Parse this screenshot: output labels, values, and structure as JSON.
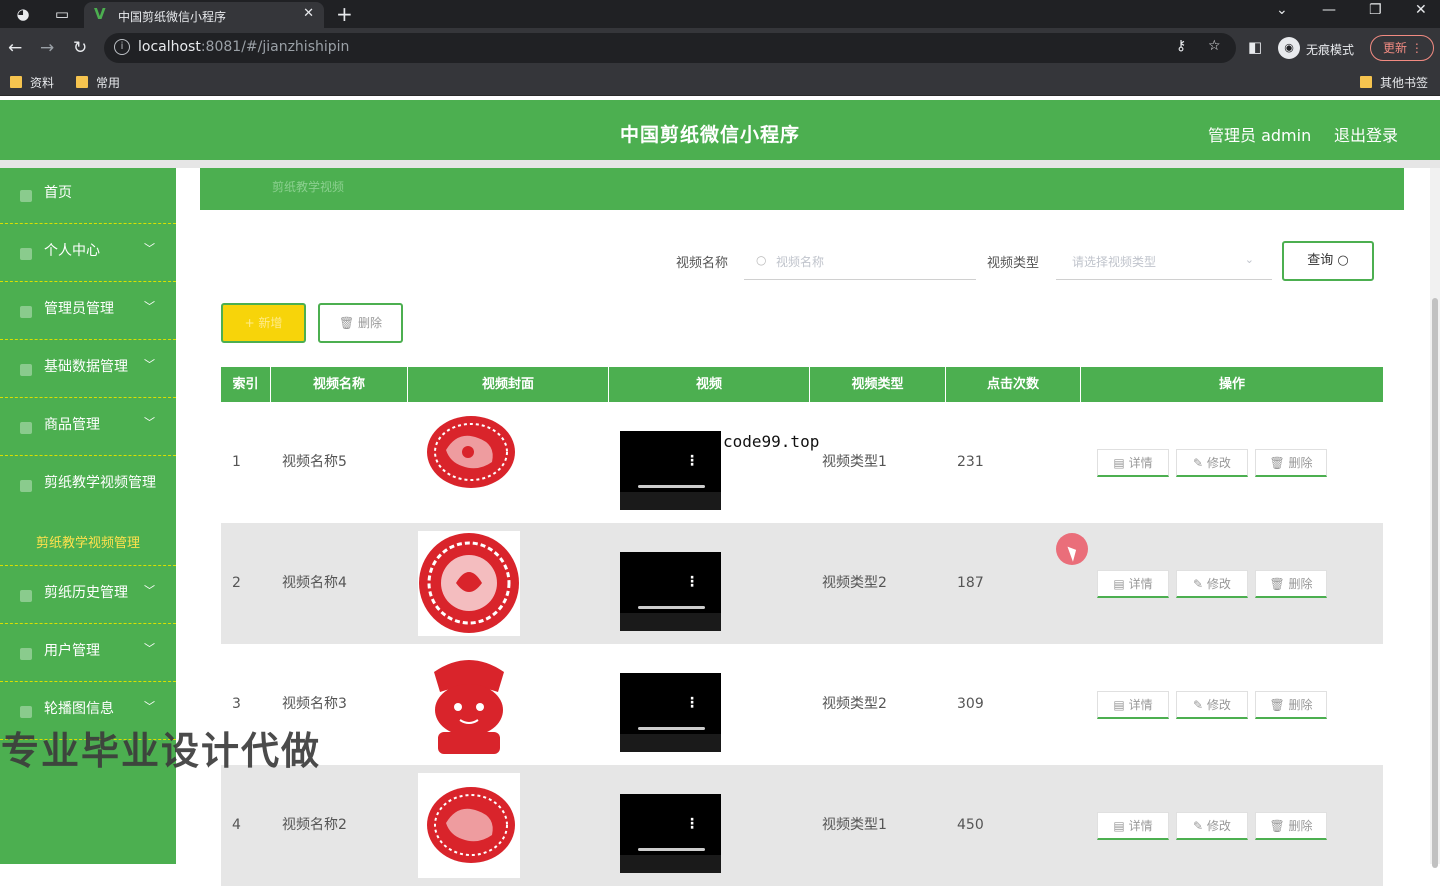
{
  "browser": {
    "tab_title": "中国剪纸微信小程序",
    "url_host": "localhost",
    "url_path": ":8081/#/jianzhishipin",
    "incognito_label": "无痕模式",
    "update_label": "更新",
    "bookmarks": [
      "资料",
      "常用"
    ],
    "other_bookmarks": "其他书签"
  },
  "header": {
    "title": "中国剪纸微信小程序",
    "admin": "管理员 admin",
    "logout": "退出登录"
  },
  "sidebar": {
    "items": [
      {
        "label": "首页"
      },
      {
        "label": "个人中心"
      },
      {
        "label": "管理员管理"
      },
      {
        "label": "基础数据管理"
      },
      {
        "label": "商品管理"
      },
      {
        "label": "剪纸教学视频管理"
      },
      {
        "label": "剪纸历史管理"
      },
      {
        "label": "用户管理"
      },
      {
        "label": "轮播图信息"
      }
    ],
    "active_sub": "剪纸教学视频管理"
  },
  "breadcrumb": "剪纸教学视频",
  "search": {
    "name_label": "视频名称",
    "name_placeholder": "视频名称",
    "type_label": "视频类型",
    "type_placeholder": "请选择视频类型",
    "query_label": "查询"
  },
  "actions": {
    "add_label": "+ 新增",
    "delete_label": "删除"
  },
  "table": {
    "headers": [
      "索引",
      "视频名称",
      "视频封面",
      "视频",
      "视频类型",
      "点击次数",
      "操作"
    ],
    "rows": [
      {
        "index": "1",
        "name": "视频名称5",
        "type": "视频类型1",
        "clicks": "231"
      },
      {
        "index": "2",
        "name": "视频名称4",
        "type": "视频类型2",
        "clicks": "187"
      },
      {
        "index": "3",
        "name": "视频名称3",
        "type": "视频类型2",
        "clicks": "309"
      },
      {
        "index": "4",
        "name": "视频名称2",
        "type": "视频类型1",
        "clicks": "450"
      }
    ],
    "row_actions": {
      "detail": "详情",
      "edit": "修改",
      "delete": "删除"
    }
  },
  "overlays": {
    "promo_text": "专业毕业设计代做",
    "watermark": "code99.top"
  },
  "colors": {
    "primary": "#4caf50",
    "add_button": "#f7d40a",
    "browser_dark": "#202124"
  }
}
